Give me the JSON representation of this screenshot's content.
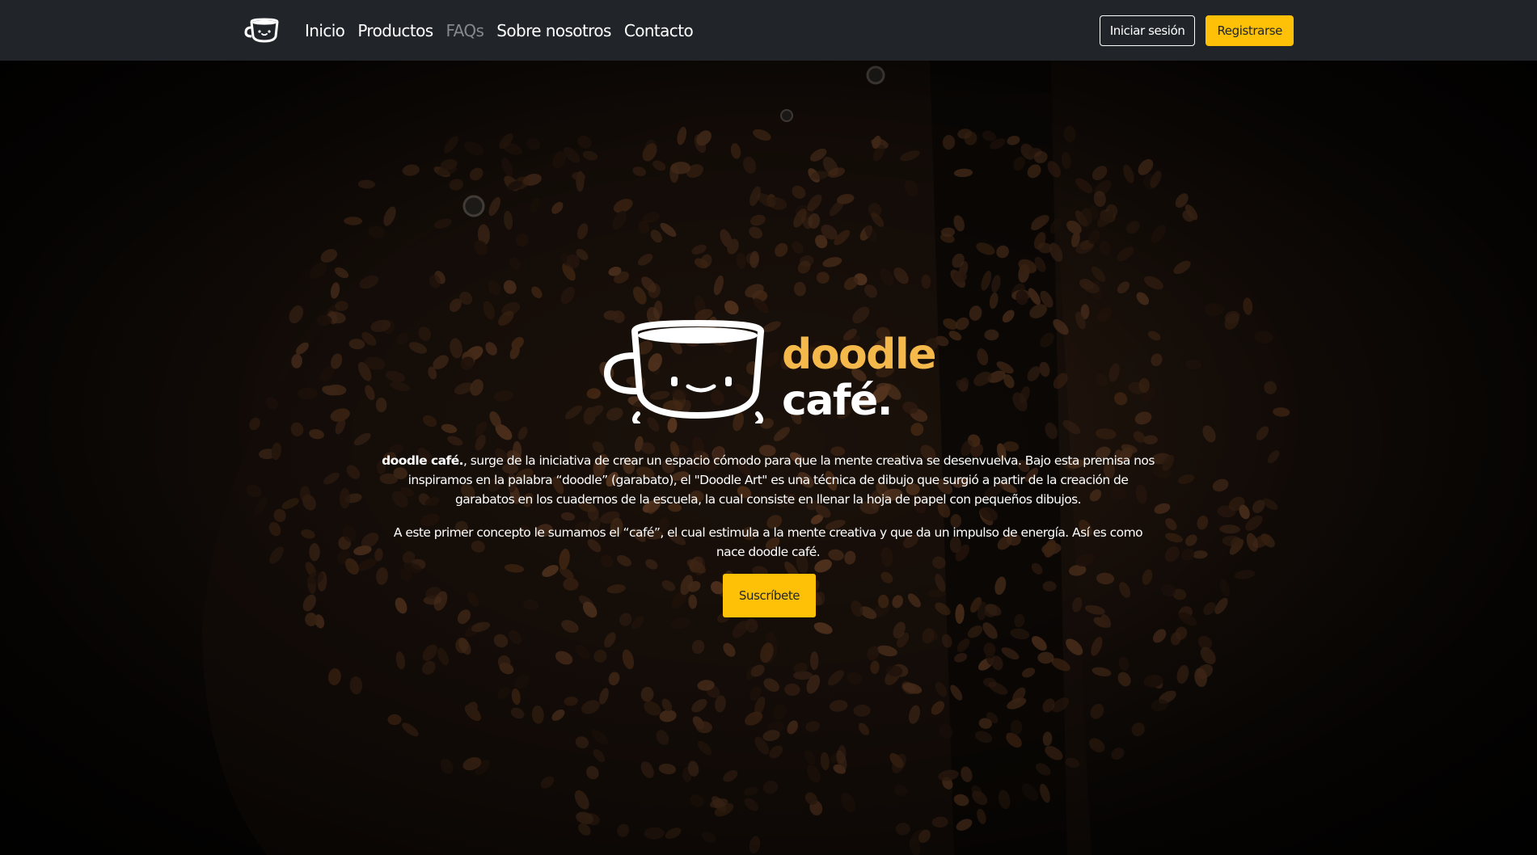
{
  "nav": {
    "brand_icon": "coffee-cup-smile-icon",
    "links": [
      {
        "label": "Inicio",
        "active": false
      },
      {
        "label": "Productos",
        "active": false
      },
      {
        "label": "FAQs",
        "active": true
      },
      {
        "label": "Sobre nosotros",
        "active": false
      },
      {
        "label": "Contacto",
        "active": false
      }
    ],
    "login_label": "Iniciar sesión",
    "register_label": "Registrarse"
  },
  "hero": {
    "logo": {
      "word1": "doodle",
      "word2": "café."
    },
    "p1_bold": "doodle café.",
    "p1_rest": ", surge de la iniciativa de crear un espacio cómodo para que la mente creativa se desenvuelva. Bajo esta premisa nos inspiramos en la palabra “doodle” (garabato), el \"Doodle Art\" es una técnica de dibujo que surgió a partir de la creación de garabatos en los cuadernos de la escuela, la cual consiste en llenar la hoja de papel con pequeños dibujos.",
    "p2": "A este primer concepto le sumamos el “café”, el cual estimula a la mente creativa y que da un impulso de energía. Así es como nace doodle café.",
    "cta_label": "Suscríbete"
  },
  "colors": {
    "navbar_bg": "#212529",
    "accent": "#ffc107",
    "logo_accent": "#f5b84a"
  }
}
